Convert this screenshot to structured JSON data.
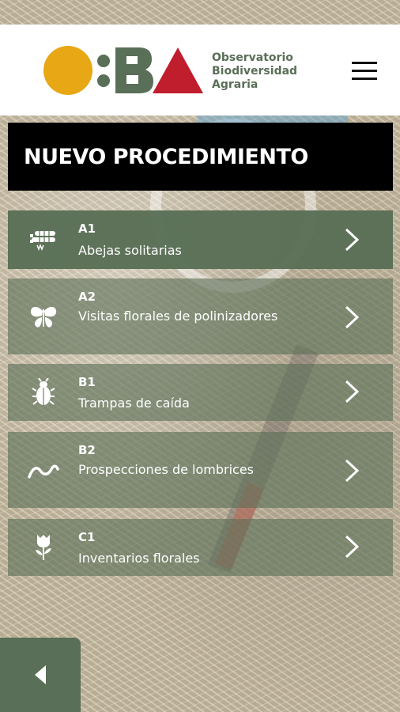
{
  "header": {
    "logo_text": "O:BA",
    "org_name_line1": "Observatorio",
    "org_name_line2": "Biodiversidad",
    "org_name_line3": "Agraria",
    "menu_icon": "hamburger-menu-icon"
  },
  "page": {
    "title": "NUEVO PROCEDIMIENTO"
  },
  "procedures": [
    {
      "code": "A1",
      "label": "Abejas solitarias",
      "icon": "bee-nest-icon"
    },
    {
      "code": "A2",
      "label": "Visitas florales de polinizadores",
      "icon": "butterfly-icon"
    },
    {
      "code": "B1",
      "label": "Trampas de caída",
      "icon": "beetle-icon"
    },
    {
      "code": "B2",
      "label": "Prospecciones de lombrices",
      "icon": "worm-icon"
    },
    {
      "code": "C1",
      "label": "Inventarios florales",
      "icon": "flower-icon"
    }
  ],
  "footer": {
    "back_icon": "back-arrow-icon"
  },
  "colors": {
    "brand_green": "#5a6f57",
    "logo_yellow": "#e8a715",
    "logo_red": "#c01d2d",
    "title_bg": "#000000"
  }
}
